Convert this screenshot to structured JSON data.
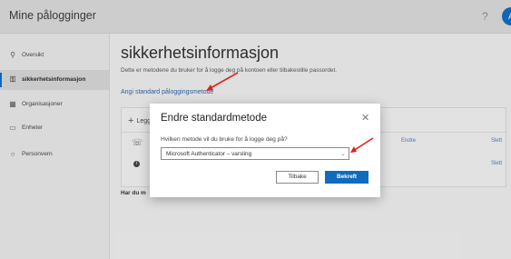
{
  "app": {
    "title": "Mine pålogginger",
    "help_icon": "question-mark-icon",
    "avatar_initial": "A"
  },
  "sidebar": {
    "items": [
      {
        "label": "Oversikt",
        "icon": "person-icon"
      },
      {
        "label": "sikkerhetsinformasjon",
        "icon": "key-icon",
        "active": true
      },
      {
        "label": "Organisasjoner",
        "icon": "organization-icon"
      },
      {
        "label": "Enheter",
        "icon": "laptop-icon"
      },
      {
        "label": "Personvern",
        "icon": "lock-icon"
      }
    ]
  },
  "main": {
    "title": "sikkerhetsinformasjon",
    "description": "Dette er metodene du bruker for å logge deg på kontoen eller tilbakestille passordet.",
    "default_method_link": "Angi standard påloggingsmetode",
    "add_method_label": "Legg",
    "method_rows": [
      {
        "icon": "phone-icon",
        "change": "Endre",
        "delete": "Slett"
      },
      {
        "icon": "info-icon",
        "delete": "Slett"
      }
    ],
    "no_device_text": "Har du m"
  },
  "dialog": {
    "title": "Endre standardmetode",
    "question": "Hvilken metode vil du bruke for å logge deg på?",
    "selected_method": "Microsoft Authenticator – varsling",
    "back_label": "Tilbake",
    "confirm_label": "Bekreft"
  },
  "colors": {
    "accent": "#0f6cbd",
    "annotation_arrow": "#e0201b",
    "link": "#2e62a6"
  }
}
